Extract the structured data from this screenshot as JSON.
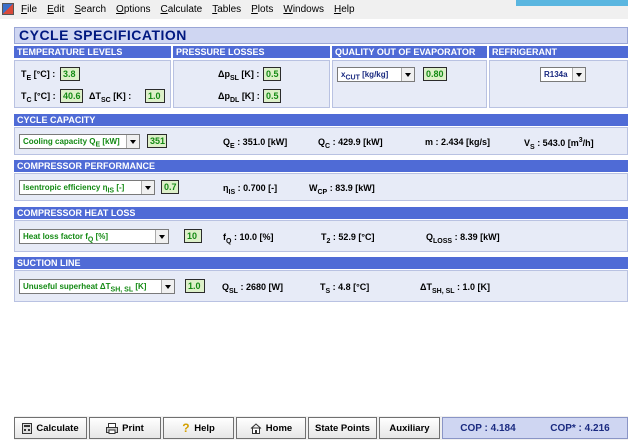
{
  "menu": {
    "items": [
      "File",
      "Edit",
      "Search",
      "Options",
      "Calculate",
      "Tables",
      "Plots",
      "Windows",
      "Help"
    ],
    "underline": [
      "F",
      "E",
      "S",
      "O",
      "C",
      "T",
      "P",
      "W",
      "H"
    ]
  },
  "title": "CYCLE SPECIFICATION",
  "headers": {
    "temperature": "TEMPERATURE LEVELS",
    "pressure": "PRESSURE LOSSES",
    "quality": "QUALITY OUT OF EVAPORATOR",
    "refrigerant": "REFRIGERANT"
  },
  "temperature": {
    "te_label": "T",
    "te_sub": "E",
    "te_unit": " [°C] :",
    "te_value": "3.8",
    "tc_label": "T",
    "tc_sub": "C",
    "tc_unit": " [°C] :",
    "tc_value": "40.6",
    "dtsc_label": "ΔT",
    "dtsc_sub": "SC",
    "dtsc_unit": " [K] :",
    "dtsc_value": "1.0"
  },
  "pressure": {
    "dpsl_label": "Δp",
    "dpsl_sub": "SL",
    "dpsl_unit": " [K] :",
    "dpsl_value": "0.5",
    "dpdl_label": "Δp",
    "dpdl_sub": "DL",
    "dpdl_unit": " [K] :",
    "dpdl_value": "0.5"
  },
  "quality": {
    "select": "x",
    "select_sub": "CUT",
    "select_unit": " [kg/kg]",
    "value": "0.80"
  },
  "refrigerant": {
    "select": "R134a"
  },
  "capacity": {
    "header": "CYCLE CAPACITY",
    "select_text": "Cooling capacity Q",
    "select_sub": "E",
    "select_unit": " [kW]",
    "value": "351",
    "qe_label": "Q",
    "qe_sub": "E",
    "qe_text": " : 351.0 [kW]",
    "qc_label": "Q",
    "qc_sub": "C",
    "qc_text": " : 429.9 [kW]",
    "m_label": "m",
    "m_text": " : 2.434 [kg/s]",
    "vs_label": "V",
    "vs_sub": "S",
    "vs_text": " : 543.0 [m",
    "vs_sup": "3",
    "vs_end": "/h]"
  },
  "compressor": {
    "header": "COMPRESSOR PERFORMANCE",
    "select_text": "Isentropic efficiency η",
    "select_sub": "IS",
    "select_unit": " [-]",
    "value": "0.7",
    "eta_label": "η",
    "eta_sub": "IS",
    "eta_text": " : 0.700 [-]",
    "wcp_label": "W",
    "wcp_sub": "CP",
    "wcp_text": " : 83.9 [kW]"
  },
  "heatloss": {
    "header": "COMPRESSOR HEAT LOSS",
    "select_text": "Heat loss factor f",
    "select_sub": "Q",
    "select_unit": " [%]",
    "value": "10",
    "fq_label": "f",
    "fq_sub": "Q",
    "fq_text": " : 10.0 [%]",
    "t2_label": "T",
    "t2_sub": "2",
    "t2_text": " : 52.9 [°C]",
    "qloss_label": "Q",
    "qloss_sub": "LOSS",
    "qloss_text": " : 8.39 [kW]"
  },
  "suction": {
    "header": "SUCTION LINE",
    "select_text": "Unuseful superheat ΔT",
    "select_sub": "SH, SL",
    "select_unit": " [K]",
    "value": "1.0",
    "qsl_label": "Q",
    "qsl_sub": "SL",
    "qsl_text": " : 2680 [W]",
    "ts_label": "T",
    "ts_sub": "S",
    "ts_text": " : 4.8 [°C]",
    "dtsh_label": "ΔT",
    "dtsh_sub": "SH, SL",
    "dtsh_text": " : 1.0 [K]"
  },
  "toolbar": {
    "calculate": "Calculate",
    "print": "Print",
    "help": "Help",
    "home": "Home",
    "state_points": "State Points",
    "auxiliary": "Auxiliary",
    "cop": "COP : 4.184",
    "cop_star": "COP* : 4.216"
  },
  "colors": {
    "header_blue": "#4f6bd6",
    "panel_bg": "#e7ebf7",
    "title_bg": "#cfd6f2",
    "value_green": "#138a13",
    "value_bg": "#ddf0c9"
  }
}
